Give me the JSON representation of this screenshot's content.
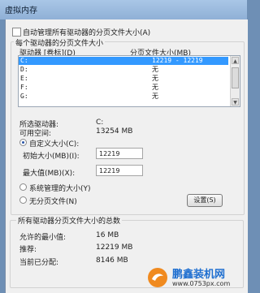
{
  "window": {
    "title": "虚拟内存"
  },
  "auto_manage": {
    "label": "自动管理所有驱动器的分页文件大小(A)",
    "checked": false
  },
  "per_drive": {
    "group_title": "每个驱动器的分页文件大小",
    "col_drive": "驱动器 [卷标](D)",
    "col_size": "分页文件大小(MB)",
    "drives": [
      {
        "drive": "C:",
        "size": "12219 - 12219",
        "selected": true
      },
      {
        "drive": "D:",
        "size": "无",
        "selected": false
      },
      {
        "drive": "E:",
        "size": "无",
        "selected": false
      },
      {
        "drive": "F:",
        "size": "无",
        "selected": false
      },
      {
        "drive": "G:",
        "size": "无",
        "selected": false
      }
    ],
    "selected_drive_label": "所选驱动器:",
    "selected_drive_value": "C:",
    "free_space_label": "可用空间:",
    "free_space_value": "13254 MB",
    "custom_size": {
      "label": "自定义大小(C):",
      "selected": true
    },
    "initial_size": {
      "label": "初始大小(MB)(I):",
      "value": "12219"
    },
    "max_size": {
      "label": "最大值(MB)(X):",
      "value": "12219"
    },
    "system_managed": {
      "label": "系统管理的大小(Y)",
      "selected": false
    },
    "no_paging": {
      "label": "无分页文件(N)",
      "selected": false
    },
    "set_button": "设置(S)"
  },
  "totals": {
    "group_title": "所有驱动器分页文件大小的总数",
    "min_label": "允许的最小值:",
    "min_value": "16 MB",
    "recommended_label": "推荐:",
    "recommended_value": "12219 MB",
    "current_label": "当前已分配:",
    "current_value": "8146 MB"
  },
  "watermark": {
    "brand": "鹏鑫装机网",
    "url": "www.0753px.com"
  }
}
